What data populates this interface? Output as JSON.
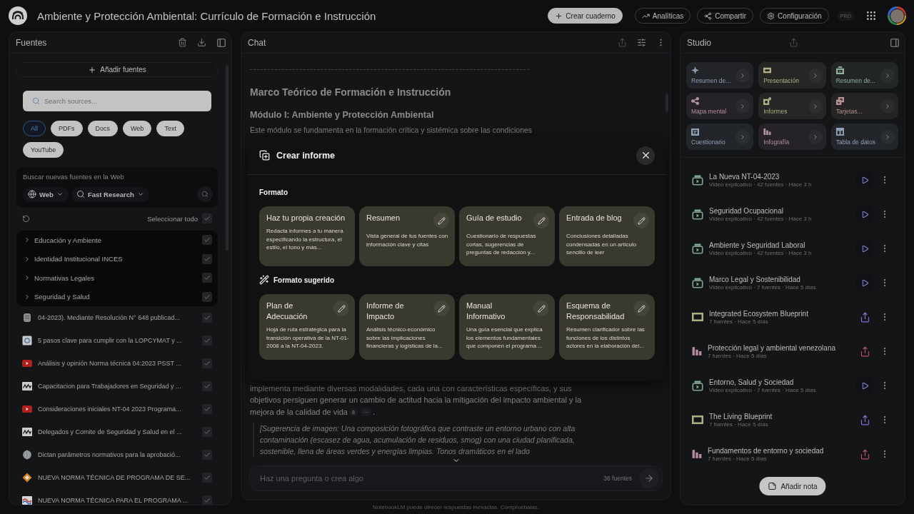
{
  "app": {
    "title": "Ambiente y Protección Ambiental: Currículo de Formación e Instrucción",
    "actions": [
      {
        "label": "Crear cuaderno",
        "kind": "primary"
      },
      {
        "label": "Analíticas",
        "kind": "analytics"
      },
      {
        "label": "Compartir",
        "kind": "share"
      },
      {
        "label": "Configuración",
        "kind": "settings"
      }
    ],
    "plan_badge": "PRO"
  },
  "sources": {
    "title": "Fuentes",
    "add_button": "Añadir fuentes",
    "search": {
      "placeholder": "Search sources..."
    },
    "filters": [
      {
        "label": "All",
        "selected": true
      },
      {
        "label": "PDFs",
        "selected": false
      },
      {
        "label": "Docs",
        "selected": false
      },
      {
        "label": "Web",
        "selected": false
      },
      {
        "label": "Text",
        "selected": false
      },
      {
        "label": "YouTube",
        "selected": false
      }
    ],
    "web_search": {
      "prompt": "Buscar nuevas fuentes en la Web",
      "scope": "Web",
      "mode": "Fast Research"
    },
    "select_all": {
      "label": "Seleccionar todo",
      "checked": true
    },
    "groups": [
      {
        "label": "Educación y Ambiente",
        "expanded": false,
        "checked": true
      },
      {
        "label": "Identidad Institucional INCES",
        "expanded": false,
        "checked": true
      },
      {
        "label": "Normativas Legales",
        "expanded": false,
        "checked": true
      },
      {
        "label": "Seguridad y Salud",
        "expanded": false,
        "checked": true
      }
    ],
    "items": [
      {
        "title": "04-2023). Mediante Resolución N° 648 publicad...",
        "kind": "doc",
        "checked": true
      },
      {
        "title": "5 pasos clave para cumplir con la LOPCYMAT y ...",
        "kind": "page",
        "checked": true
      },
      {
        "title": "Análisis y opinión Norma técnica 04:2023 PSST ...",
        "kind": "video",
        "checked": true
      },
      {
        "title": "Capacitacion para Trabajadores en Seguridad y ...",
        "kind": "logo",
        "checked": true
      },
      {
        "title": "Consideraciones iniciales NT-04 2023 Programa...",
        "kind": "video",
        "checked": true
      },
      {
        "title": "Delegados y Comite de Seguridad y Salud en el ...",
        "kind": "logo",
        "checked": true
      },
      {
        "title": "Dictan parámetros normativos para la aprobació...",
        "kind": "globe",
        "checked": true
      },
      {
        "title": "NUEVA NORMA TÉCNICA DE PROGRAMA DE SE...",
        "kind": "diamond",
        "checked": true
      },
      {
        "title": "NUEVA NORMA TÉCNICA PARA EL PROGRAMA ...",
        "kind": "wave",
        "checked": true
      }
    ]
  },
  "chat": {
    "title": "Chat",
    "heading": "Marco Teórico de Formación e Instrucción",
    "subheading": "Módulo I: Ambiente y Protección Ambiental",
    "intro": "Este módulo se fundamenta en la formación crítica y sistémica sobre las condiciones",
    "body": "implementa mediante diversas modalidades, cada una con características específicas, y sus objetivos persiguen generar un cambio de actitud hacia la mitigación del impacto ambiental y la mejora de la calidad de vida",
    "citations": [
      "8",
      "···"
    ],
    "body_end": ".",
    "image_suggestion": "[Sugerencia de imagen: Una composición fotográfica que contraste un entorno urbano con alta contaminación (escasez de agua, acumulación de residuos, smog) con una ciudad planificada, sostenible, llena de áreas verdes y energías limpias. Tonos dramáticos en el lado",
    "input": {
      "placeholder": "Haz una pregunta o crea algo",
      "source_count": "36 fuentes"
    },
    "disclaimer": "NotebookLM puede ofrecer respuestas inexactas. Compruébalas."
  },
  "report_dialog": {
    "title": "Crear informe",
    "sections": [
      {
        "title": "Formato",
        "kind": "formats",
        "cards": [
          {
            "title": "Haz tu propia creación",
            "description": "Redacta informes a tu manera especificando la estructura, el estilo, el tono y más...",
            "editable": false
          },
          {
            "title": "Resumen",
            "description": "Vista general de tus fuentes con información clave y citas",
            "editable": true
          },
          {
            "title": "Guía de estudio",
            "description": "Cuestionario de respuestas cortas, sugerencias de preguntas de redacción y...",
            "editable": true
          },
          {
            "title": "Entrada de blog",
            "description": "Conclusiones detalladas condensadas en un artículo sencillo de leer",
            "editable": true
          }
        ]
      },
      {
        "title": "Formato sugerido",
        "kind": "suggested",
        "cards": [
          {
            "title": "Plan de Adecuación",
            "description": "Hoja de ruta estratégica para la transición operativa de la NT-01-2008 a la NT-04-2023.",
            "editable": true
          },
          {
            "title": "Informe de Impacto",
            "description": "Análisis técnico-económico sobre las implicaciones financieras y logísticas de la...",
            "editable": true
          },
          {
            "title": "Manual Informativo",
            "description": "Una guía esencial que explica los elementos fundamentales que componen el programa ...",
            "editable": true
          },
          {
            "title": "Esquema de Responsabilidad",
            "description": "Resumen clarificador sobre las funciones de los distintos actores en la elaboración del...",
            "editable": true
          }
        ]
      }
    ]
  },
  "studio": {
    "title": "Studio",
    "tools": [
      {
        "label": "Resumen de...",
        "kind": "audio",
        "color": "#8f9bb6"
      },
      {
        "label": "Presentación",
        "kind": "slides",
        "color": "#b3b089"
      },
      {
        "label": "Resumen de...",
        "kind": "video",
        "color": "#8fae98"
      },
      {
        "label": "Mapa mental",
        "kind": "mindmap",
        "color": "#b58fa6"
      },
      {
        "label": "Informes",
        "kind": "report",
        "color": "#b3b089"
      },
      {
        "label": "Tarjetas...",
        "kind": "flashcards",
        "color": "#b59291"
      },
      {
        "label": "Cuestionario",
        "kind": "quiz",
        "color": "#8fa2b6"
      },
      {
        "label": "Infografía",
        "kind": "infographic",
        "color": "#b58fa9"
      },
      {
        "label": "Tabla de datos",
        "kind": "table",
        "color": "#8fa1b6"
      }
    ],
    "artifacts": [
      {
        "title": "La Nueva NT-04-2023",
        "meta": "Video explicativo · 42 fuentes · Hace 3 h",
        "kind": "video"
      },
      {
        "title": "Seguridad Ocupacional",
        "meta": "Video explicativo · 42 fuentes · Hace 3 h",
        "kind": "video"
      },
      {
        "title": "Ambiente y Seguridad Laboral",
        "meta": "Video explicativo · 42 fuentes · Hace 3 h",
        "kind": "video"
      },
      {
        "title": "Marco Legal y Sostenibilidad",
        "meta": "Video explicativo · 7 fuentes · Hace 5 días",
        "kind": "video"
      },
      {
        "title": "Integrated Ecosystem Blueprint",
        "meta": "7 fuentes · Hace 5 días",
        "kind": "slides"
      },
      {
        "title": "Protección legal y ambiental venezolana",
        "meta": "7 fuentes · Hace 5 días",
        "kind": "infographic"
      },
      {
        "title": "Entorno, Salud y Sociedad",
        "meta": "Video explicativo · 7 fuentes · Hace 5 días",
        "kind": "video"
      },
      {
        "title": "The Living Blueprint",
        "meta": "7 fuentes · Hace 5 días",
        "kind": "slides"
      },
      {
        "title": "Fundamentos de entorno y sociedad",
        "meta": "7 fuentes · Hace 5 días",
        "kind": "infographic"
      }
    ],
    "add_note": "Añadir nota"
  }
}
